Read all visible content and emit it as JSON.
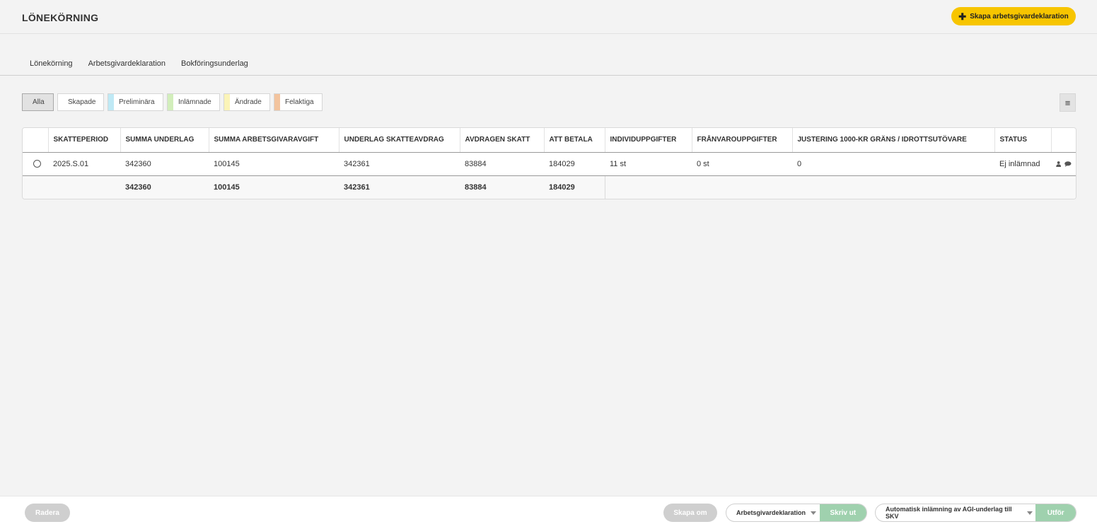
{
  "header": {
    "title": "LÖNEKÖRNING",
    "create_button": "Skapa arbetsgivardeklaration"
  },
  "tabs": [
    {
      "label": "Lönekörning",
      "active": false
    },
    {
      "label": "Arbetsgivardeklaration",
      "active": true
    },
    {
      "label": "Bokföringsunderlag",
      "active": false
    }
  ],
  "filters": [
    {
      "label": "Alla",
      "active": true,
      "color": ""
    },
    {
      "label": "Skapade",
      "active": false,
      "color": ""
    },
    {
      "label": "Preliminära",
      "active": false,
      "color": "#bfe9f5"
    },
    {
      "label": "Inlämnade",
      "active": false,
      "color": "#d2eebb"
    },
    {
      "label": "Ändrade",
      "active": false,
      "color": "#fbf4b8"
    },
    {
      "label": "Felaktiga",
      "active": false,
      "color": "#f3c49e"
    }
  ],
  "table": {
    "columns": [
      "SKATTEPERIOD",
      "SUMMA UNDERLAG",
      "SUMMA ARBETSGIVARAVGIFT",
      "UNDERLAG SKATTEAVDRAG",
      "AVDRAGEN SKATT",
      "ATT BETALA",
      "INDIVIDUPPGIFTER",
      "FRÅNVAROUPPGIFTER",
      "JUSTERING 1000-KR GRÄNS / IDROTTSUTÖVARE",
      "STATUS"
    ],
    "rows": [
      {
        "skatteperiod": "2025.S.01",
        "summa_underlag": "342360",
        "summa_arbetsgivaravgift": "100145",
        "underlag_skatteavdrag": "342361",
        "avdragen_skatt": "83884",
        "att_betala": "184029",
        "individuppgifter": "11 st",
        "franvarouppgifter": "0 st",
        "justering": "0",
        "status": "Ej inlämnad"
      }
    ],
    "totals": {
      "summa_underlag": "342360",
      "summa_arbetsgivaravgift": "100145",
      "underlag_skatteavdrag": "342361",
      "avdragen_skatt": "83884",
      "att_betala": "184029"
    }
  },
  "footer": {
    "delete_button": "Radera",
    "recreate_button": "Skapa om",
    "print_select": "Arbetsgivardeklaration",
    "print_button": "Skriv ut",
    "action_select": "Automatisk inlämning av AGI-underlag till SKV",
    "action_button": "Utför"
  },
  "colors": {
    "accent": "#f7c500",
    "action_green": "#9fd1ae",
    "active_tab_underline": "#2e6b2e"
  }
}
